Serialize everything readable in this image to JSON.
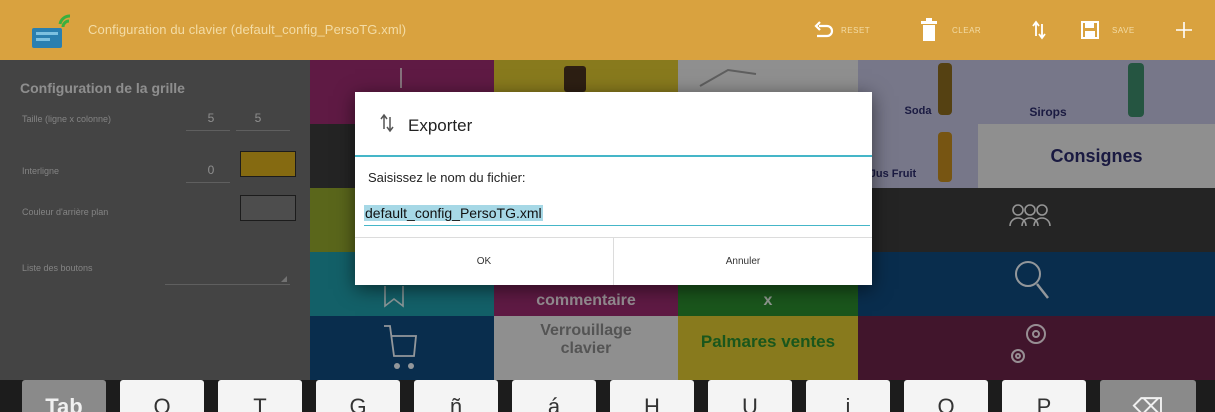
{
  "action_bar": {
    "title": "Configuration du clavier (default_config_PersoTG.xml)",
    "actions": [
      {
        "icon": "undo-icon",
        "label": "RESET"
      },
      {
        "icon": "trash-icon",
        "label": "CLEAR"
      },
      {
        "icon": "import-export-icon",
        "label": ""
      },
      {
        "icon": "save-icon",
        "label": "SAVE"
      },
      {
        "icon": "add-icon",
        "label": ""
      }
    ]
  },
  "left_panel": {
    "title": "Configuration de la grille",
    "size_label": "Taille (ligne x colonne)",
    "rows": "5",
    "cols": "5",
    "spacing_label": "Interligne",
    "spacing_value": "0",
    "spacing_color": "#d7ac1c",
    "background_label": "Couleur d'arrière plan",
    "background_color": "#7c7c7c",
    "buttons_label": "Liste des boutons"
  },
  "grid": {
    "tile_labels": {
      "consignes": "Consignes",
      "commentaire": "commentaire",
      "x": "x",
      "verrouillage": "Verrouillage clavier",
      "palmares": "Palmares ventes",
      "sirops": "Sirops",
      "soda": "Soda",
      "jus_fruit": "Jus Fruit"
    },
    "colors": {
      "magenta": "#9a2a6e",
      "yellow": "#dcc630",
      "olive": "#92a52d",
      "teal": "#1f9ba9",
      "green": "#2a8c2e",
      "navy": "#0f4a7c",
      "plum": "#6a2247",
      "pale": "#e7e7e7",
      "lavender": "#c1c1dd"
    }
  },
  "dialog": {
    "title": "Exporter",
    "message": "Saisissez le nom du fichier:",
    "filename": "default_config_PersoTG.xml",
    "ok_label": "OK",
    "cancel_label": "Annuler",
    "accent_color": "#45b6c8"
  },
  "keyboard": {
    "keys": [
      "Tab",
      "Q",
      "T",
      "G",
      "ñ",
      "á",
      "H",
      "U",
      "i",
      "O",
      "P",
      "⌫"
    ]
  }
}
